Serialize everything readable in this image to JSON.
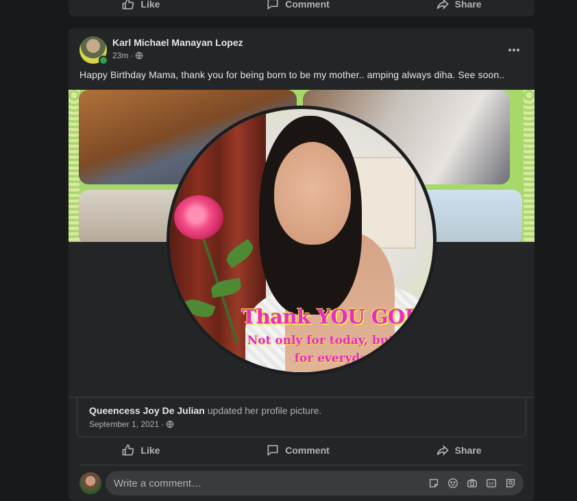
{
  "previous_post": {
    "actions": {
      "like": "Like",
      "comment": "Comment",
      "share": "Share"
    }
  },
  "post": {
    "author": "Karl Michael Manayan Lopez",
    "time": "23m",
    "privacy_icon": "globe-icon",
    "more_icon": "more-options-icon",
    "caption": "Happy Birthday Mama, thank you for being born to be my mother.. amping always diha. See soon..",
    "image_text": {
      "headline": "Thank YOU GOD!",
      "line1": "Not only for today, but also",
      "line2": "for everyday."
    },
    "shared": {
      "name": "Queencess Joy De Julian",
      "action": "updated her profile picture.",
      "date": "September 1, 2021"
    },
    "actions": {
      "like": "Like",
      "comment": "Comment",
      "share": "Share"
    },
    "comment_placeholder": "Write a comment…",
    "comment_icons": [
      "sticker-icon",
      "emoji-icon",
      "camera-icon",
      "gif-icon",
      "avatar-sticker-icon"
    ]
  },
  "colors": {
    "background": "#18191a",
    "card": "#242526",
    "text_primary": "#e4e6eb",
    "text_secondary": "#b0b3b8",
    "online": "#31a24c",
    "overlay_magenta": "#e82cc6",
    "overlay_yellow": "#f6e24a"
  }
}
